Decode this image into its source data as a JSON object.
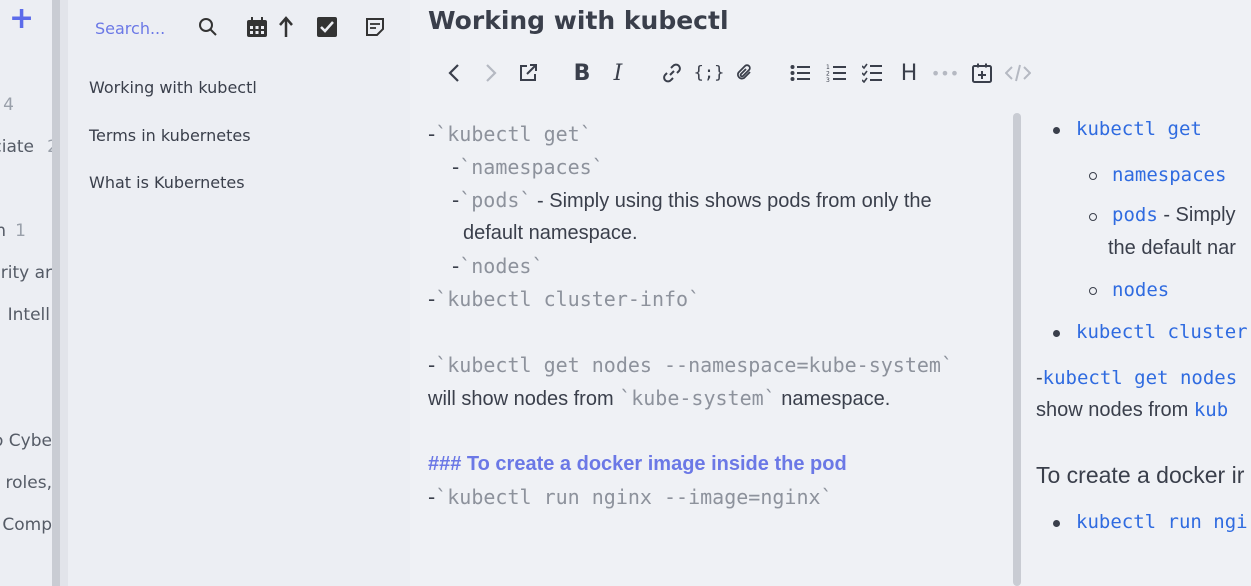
{
  "sidebar": {
    "add_label": "+",
    "items": [
      {
        "text": "",
        "count": "4"
      },
      {
        "text": "ciate",
        "count": "2"
      },
      {
        "text": "n",
        "count": "1"
      },
      {
        "text": "urity ar",
        "count": ""
      },
      {
        "text": "Intell",
        "count": ""
      },
      {
        "text": "o Cybe",
        "count": ""
      },
      {
        "text": "y roles,",
        "count": ""
      },
      {
        "text": "Comp",
        "count": ""
      }
    ]
  },
  "note_list": {
    "search_placeholder": "Search...",
    "notes": [
      "Working with kubectl",
      "Terms in kubernetes",
      "What is Kubernetes"
    ]
  },
  "editor": {
    "title": "Working with kubectl",
    "markdown": {
      "l1_code": "`kubectl get`",
      "l2_code": "`namespaces`",
      "l3_code": "`pods`",
      "l3_text": " - Simply using this shows pods from only the",
      "l4_text": "default namespace.",
      "l5_code": "`nodes`",
      "l6_code": "`kubectl cluster-info`",
      "l8_code": "`kubectl get nodes --namespace=kube-system`",
      "l9_text_a": "will show nodes from ",
      "l9_code": "`kube-system`",
      "l9_text_b": " namespace.",
      "l11_heading": "### To create a docker image inside the pod",
      "l12_code": "`kubectl run nginx --image=nginx`",
      "dash": "-"
    },
    "preview": {
      "p1": "kubectl get",
      "p2": "namespaces",
      "p3_code": "pods",
      "p3_text": " - Simply",
      "p4": "the default nar",
      "p5": "nodes",
      "p6": "kubectl cluster",
      "p7_dash": "-",
      "p7_code": "kubectl get nodes",
      "p8_text": "show nodes from ",
      "p8_code": "kub",
      "p9": "To create a docker ir",
      "p10": "kubectl run ngi"
    }
  },
  "colors": {
    "accent": "#6b78e6",
    "link": "#2f6be0"
  }
}
